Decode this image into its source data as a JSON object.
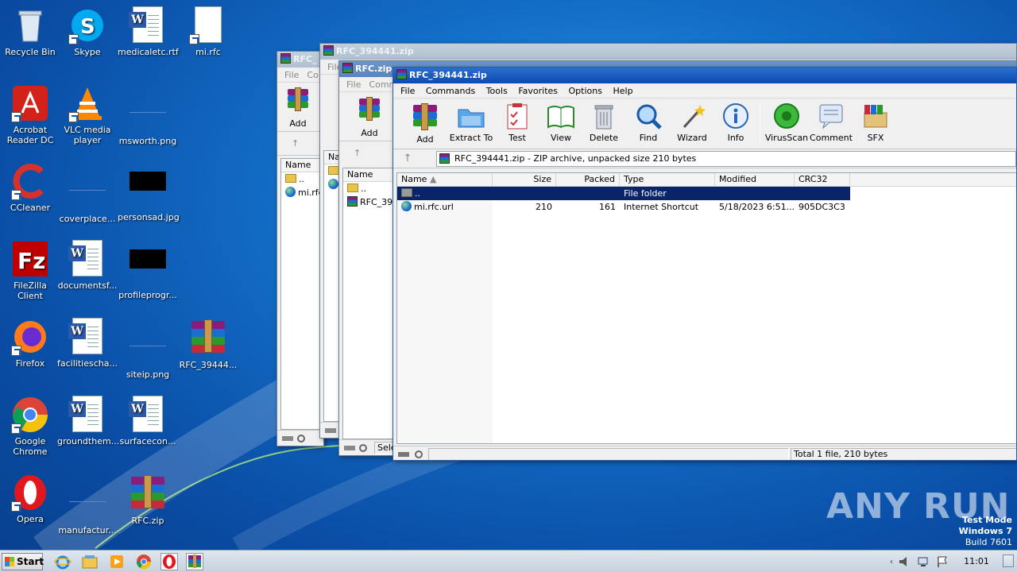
{
  "desktop": {
    "icons": [
      {
        "label": "Recycle Bin"
      },
      {
        "label": "Skype"
      },
      {
        "label": "medicaletc.rtf"
      },
      {
        "label": "mi.rfc"
      },
      {
        "label": "Acrobat Reader DC"
      },
      {
        "label": "VLC media player"
      },
      {
        "label": "msworth.png"
      },
      {
        "label": "CCleaner"
      },
      {
        "label": "coverplace..."
      },
      {
        "label": "personsad.jpg"
      },
      {
        "label": "FileZilla Client"
      },
      {
        "label": "documentsf..."
      },
      {
        "label": "profileprogr..."
      },
      {
        "label": "Firefox"
      },
      {
        "label": "facilitiescha..."
      },
      {
        "label": "siteip.png"
      },
      {
        "label": "RFC_39444..."
      },
      {
        "label": "Google Chrome"
      },
      {
        "label": "groundthem..."
      },
      {
        "label": "surfacecon..."
      },
      {
        "label": "Opera"
      },
      {
        "label": "manufactur..."
      },
      {
        "label": "RFC.zip"
      }
    ]
  },
  "back_window_1": {
    "title": "RFC_",
    "menu": [
      "File",
      "Co"
    ],
    "add_label": "Add",
    "col_name": "Name",
    "rows": [
      "..",
      "mi.rfc"
    ]
  },
  "back_window_2": {
    "title": "RFC_394441.zip",
    "menu": [
      "File"
    ],
    "col_name": "Na"
  },
  "back_window_3": {
    "title": "RFC.zip",
    "menu": [
      "File",
      "Comma"
    ],
    "add_label": "Add",
    "col_name": "Name",
    "rows": [
      "..",
      "RFC_394"
    ],
    "status": "Sele"
  },
  "main_window": {
    "title": "RFC_394441.zip",
    "menu": [
      "File",
      "Commands",
      "Tools",
      "Favorites",
      "Options",
      "Help"
    ],
    "toolbar": [
      {
        "label": "Add",
        "icon": "add-icon"
      },
      {
        "label": "Extract To",
        "icon": "extract-to-icon"
      },
      {
        "label": "Test",
        "icon": "test-icon"
      },
      {
        "label": "View",
        "icon": "view-icon"
      },
      {
        "label": "Delete",
        "icon": "delete-icon"
      },
      {
        "label": "Find",
        "icon": "find-icon"
      },
      {
        "label": "Wizard",
        "icon": "wizard-icon"
      },
      {
        "label": "Info",
        "icon": "info-icon"
      },
      {
        "label": "VirusScan",
        "icon": "virusscan-icon"
      },
      {
        "label": "Comment",
        "icon": "comment-icon"
      },
      {
        "label": "SFX",
        "icon": "sfx-icon"
      }
    ],
    "address": "RFC_394441.zip - ZIP archive, unpacked size 210 bytes",
    "columns": {
      "name": "Name",
      "size": "Size",
      "packed": "Packed",
      "type": "Type",
      "modified": "Modified",
      "crc": "CRC32"
    },
    "rows": [
      {
        "name": "..",
        "size": "",
        "packed": "",
        "type": "File folder",
        "modified": "",
        "crc": ""
      },
      {
        "name": "mi.rfc.url",
        "size": "210",
        "packed": "161",
        "type": "Internet Shortcut",
        "modified": "5/18/2023 6:51...",
        "crc": "905DC3C3"
      }
    ],
    "status": "Total 1 file, 210 bytes"
  },
  "watermark": "ANY RUN",
  "test_mode": {
    "line1": "Test Mode",
    "line2": "Windows 7",
    "line3": "Build 7601"
  },
  "taskbar": {
    "start_label": "Start",
    "clock": "11:01 PM"
  }
}
